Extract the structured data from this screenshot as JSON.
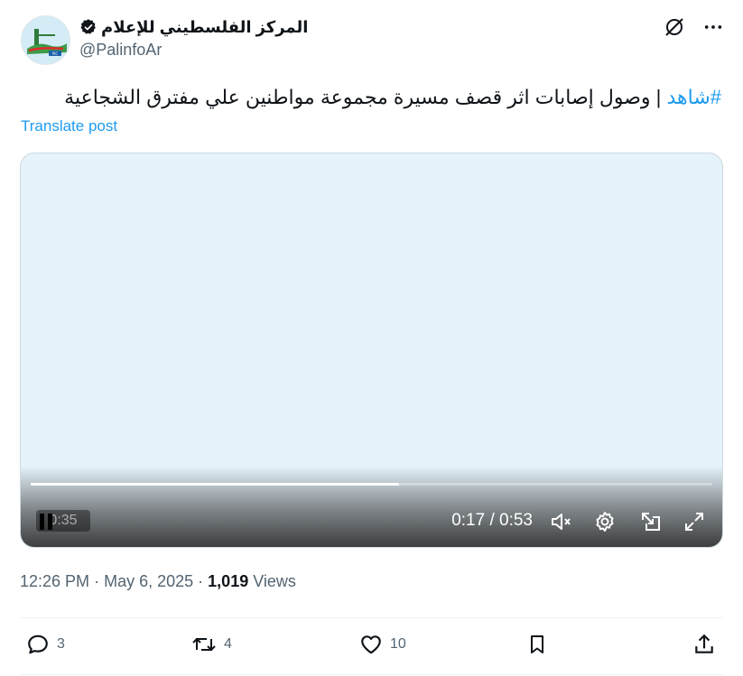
{
  "author": {
    "name": "المركز الفلسطيني للإعلام",
    "handle": "@PalinfoAr",
    "verified": true,
    "avatar_icon": "palinfo-logo"
  },
  "header_icons": [
    "grok-icon",
    "more-icon"
  ],
  "tweet": {
    "hashtag": "#شاهد",
    "text": " | وصول إصابات اثر قصف مسيرة مجموعة مواطنين علي مفترق الشجاعية",
    "translate_label": "Translate post"
  },
  "video": {
    "duration_chip": "0:35",
    "time_display": "0:17 / 0:53",
    "progress_fraction": 0.54,
    "controls": [
      "pause-icon",
      "mute-icon",
      "settings-icon",
      "popout-icon",
      "fullscreen-icon"
    ]
  },
  "meta": {
    "time": "12:26 PM",
    "separator": "·",
    "date": "May 6, 2025",
    "views_count": "1,019",
    "views_label": "Views"
  },
  "actions": {
    "replies": "3",
    "reposts": "4",
    "likes": "10"
  },
  "colors": {
    "accent": "#1d9bf0",
    "secondary_text": "#536471",
    "primary_text": "#0f1419"
  }
}
